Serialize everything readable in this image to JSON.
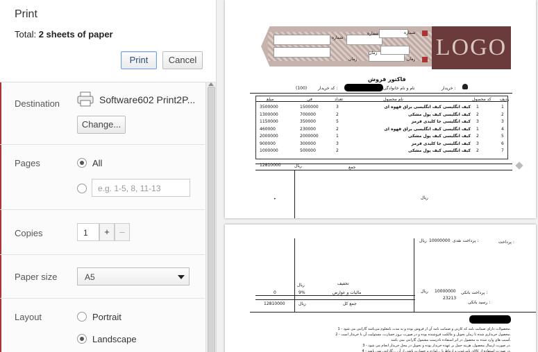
{
  "header": {
    "title": "Print",
    "total_prefix": "Total: ",
    "total_value": "2 sheets of paper",
    "print_label": "Print",
    "cancel_label": "Cancel"
  },
  "destination": {
    "label": "Destination",
    "printer_name": "Software602 Print2P...",
    "change_label": "Change..."
  },
  "pages": {
    "label": "Pages",
    "all_label": "All",
    "range_placeholder": "e.g. 1-5, 8, 11-13"
  },
  "copies": {
    "label": "Copies",
    "value": "1",
    "plus": "+",
    "minus": "–"
  },
  "paper_size": {
    "label": "Paper size",
    "value": "A5"
  },
  "layout": {
    "label": "Layout",
    "portrait_label": "Portrait",
    "landscape_label": "Landscape"
  },
  "invoice": {
    "logo_text": "LOGO",
    "label_number": "شماره",
    "label_time": "زمان",
    "title": "فاکتور فروش",
    "buyer_label": "خریدار :",
    "name_label": "نام و نام خانوادگی",
    "buyer_code_label": "کد خریدار :",
    "buyer_code": "(100)",
    "col_row": "ردیف",
    "col_code": "کد محصول",
    "col_name": "نام محصول",
    "col_qty": "تعداد",
    "col_price": "فی",
    "col_amount": "مبلغ",
    "rows": [
      {
        "n": "1",
        "code": "1",
        "name": "کیف انگلیسی کیف انگلیسی براق قهوه ای",
        "qty": "3",
        "price": "1500000",
        "amount": "3500000"
      },
      {
        "n": "2",
        "code": "2",
        "name": "کیف انگلیسی کیف پول مشکی",
        "qty": "2",
        "price": "700000",
        "amount": "1300000"
      },
      {
        "n": "3",
        "code": "3",
        "name": "کیف انگلیسی جا کلیدی قرمز",
        "qty": "5",
        "price": "350000",
        "amount": "1150000"
      },
      {
        "n": "4",
        "code": "1",
        "name": "کیف انگلیسی کیف انگلیسی براق قهوه ای",
        "qty": "2",
        "price": "230000",
        "amount": "460000"
      },
      {
        "n": "5",
        "code": "2",
        "name": "کیف انگلیسی کیف پول مشکی",
        "qty": "1",
        "price": "2000000",
        "amount": "2000000"
      },
      {
        "n": "6",
        "code": "3",
        "name": "کیف انگلیسی جا کلیدی قرمز",
        "qty": "3",
        "price": "300000",
        "amount": "900000"
      },
      {
        "n": "7",
        "code": "2",
        "name": "کیف انگلیسی کیف پول مشکی",
        "qty": "2",
        "price": "500000",
        "amount": "1000000"
      }
    ],
    "sum_label": "جمع",
    "sum_value": "12810000",
    "rial_label": "ریال",
    "cash_label": "پرداخت نقدی :",
    "cash_value": "10000000",
    "payment_label": "پرداخت :",
    "discount_label": "تخفیف",
    "discount_value": "0",
    "tax_label": "مالیات و عوارض",
    "tax_pct": "9%",
    "total_label": "جمع کل",
    "total_value": "12810000",
    "bank_label": "پرداخت بانکی :",
    "bank_value": "10000000",
    "receipt_label": "رسید بانکی :",
    "receipt_value": "23213",
    "notes": [
      "1 - محصولات دارای ضمانت نامه که کارتی و ضمانت نامه آن از فروش بوده و به مدت نامعلوم می‌باشد گارانتی می شود.",
      "2 - محصول خریداری شده تا زمان تحویل و مالکیت فروشنده بوده و در صورت بروز خسارت، مسئولیت آن با خریدار است.",
      "آسیب های وارد شده به محصول در اثر استفاده نادرست مشمول گارانتی نمی باشد.",
      "3 - در صورت ارسال محصول، هزینه حمل بر عهده خریدار بوده و تحویل در محل خریدار انجام می شود.",
      "4 - در صورت استفاده از کالای نامرغوب و ارتباط با ...لوازم و خسارت ناشی از آن ...گارانتی نمی باشد."
    ]
  }
}
